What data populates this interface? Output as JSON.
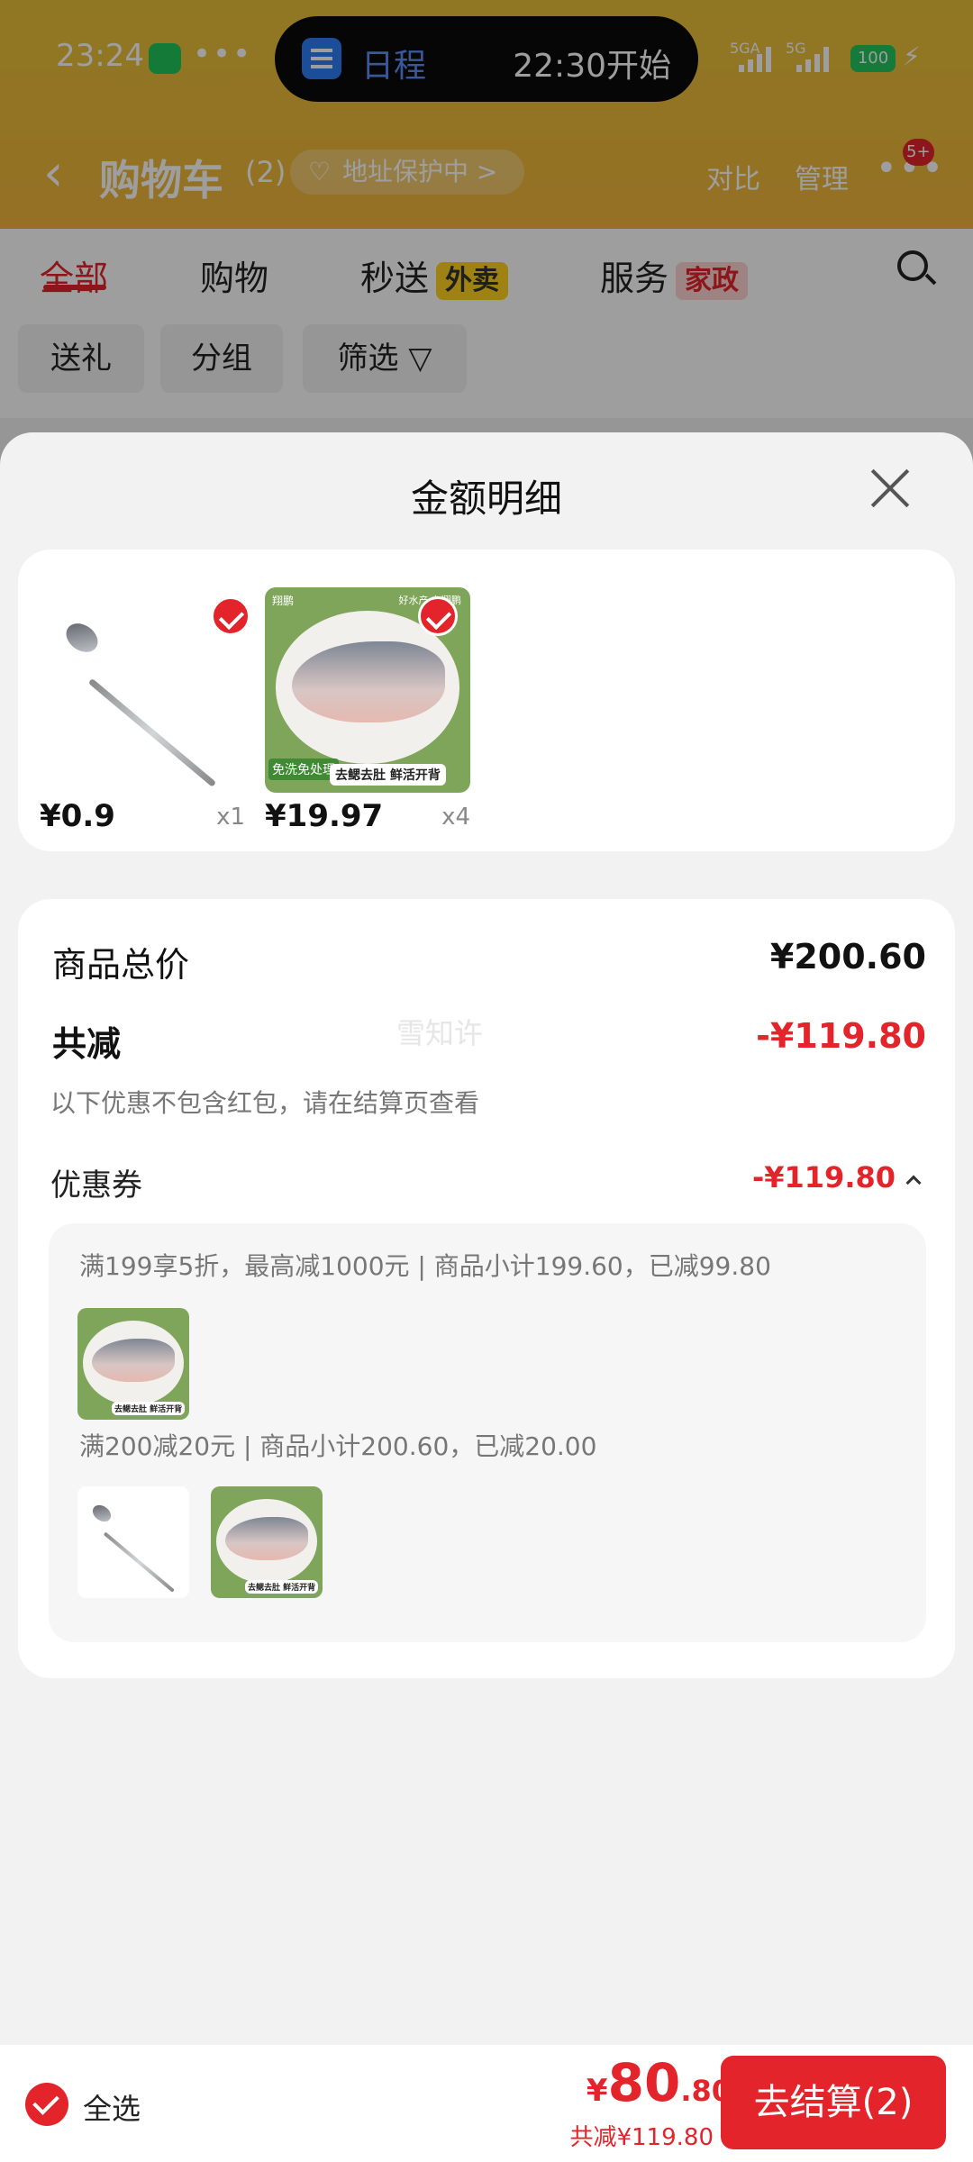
{
  "status_bar": {
    "time": "23:24",
    "dots": "•••",
    "island_label": "日程",
    "island_time": "22:30开始",
    "signal_a": "5GA",
    "signal_b": "5G",
    "battery": "100"
  },
  "nav": {
    "title": "购物车",
    "count": "(2)",
    "address_pill": "地址保护中 >",
    "compare": "对比",
    "manage": "管理",
    "badge": "5+"
  },
  "tabs": [
    {
      "label": "全部"
    },
    {
      "label": "购物"
    },
    {
      "label": "秒送",
      "tag": "外卖"
    },
    {
      "label": "服务",
      "tag": "家政"
    }
  ],
  "chips": [
    "送礼",
    "分组",
    "筛选"
  ],
  "sheet": {
    "title": "金额明细",
    "products": [
      {
        "price": "¥0.9",
        "qty": "x1"
      },
      {
        "price": "¥19.97",
        "qty": "x4",
        "img_brand": "翔鹏",
        "img_tag": "好水产·在翔鹏",
        "img_label1": "免洗免处理",
        "img_label2": "去鳃去肚 鲜活开背"
      }
    ],
    "summary": {
      "total_label": "商品总价",
      "total_value": "¥200.60",
      "reduce_label": "共减",
      "reduce_value": "-¥119.80",
      "watermark": "雪知许",
      "note": "以下优惠不包含红包，请在结算页查看",
      "coupon_label": "优惠券",
      "coupon_value": "-¥119.80"
    },
    "coupons": [
      {
        "text": "满199享5折，最高减1000元 | 商品小计199.60，已减99.80"
      },
      {
        "text": "满200减20元 | 商品小计200.60，已减20.00"
      }
    ]
  },
  "bottom": {
    "select_all": "全选",
    "currency": "¥",
    "total_int": "80",
    "total_dec": ".80",
    "reduce": "共减¥119.80",
    "checkout": "去结算(2)"
  },
  "colors": {
    "accent": "#e3242b",
    "header": "#e9c13a"
  }
}
